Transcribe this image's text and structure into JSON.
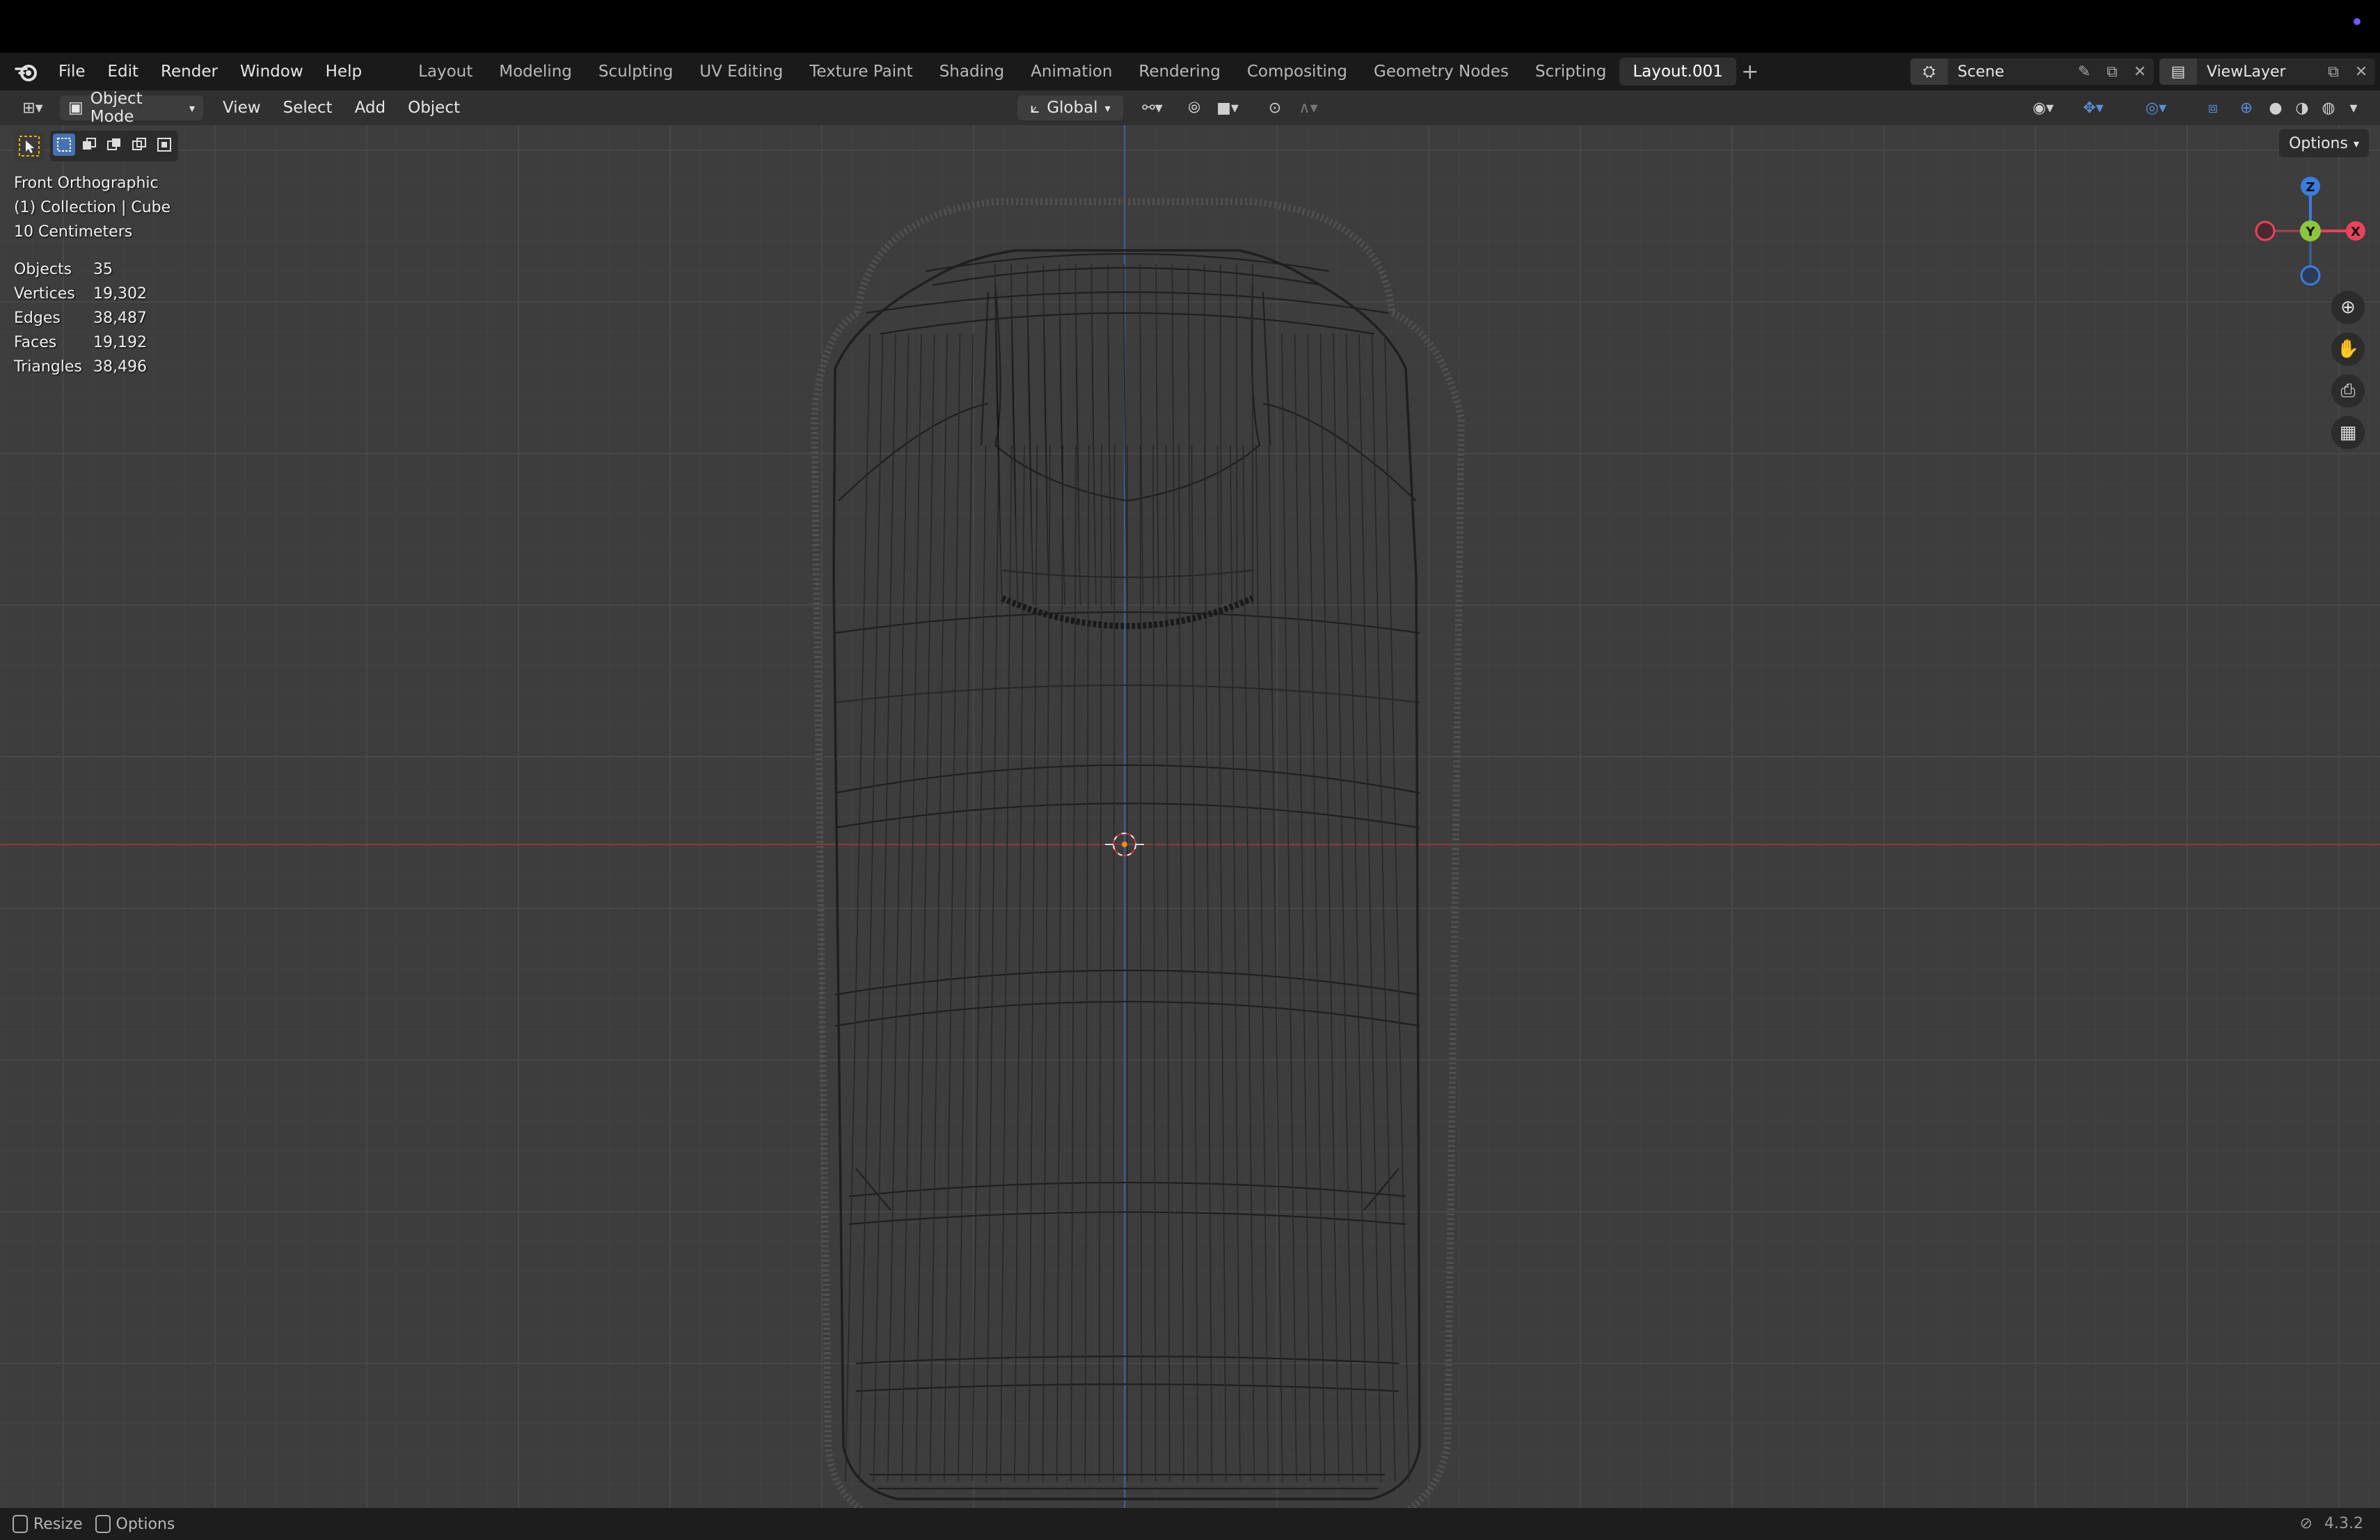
{
  "menubar": {
    "items": [
      "File",
      "Edit",
      "Render",
      "Window",
      "Help"
    ],
    "workspaces": [
      "Layout",
      "Modeling",
      "Sculpting",
      "UV Editing",
      "Texture Paint",
      "Shading",
      "Animation",
      "Rendering",
      "Compositing",
      "Geometry Nodes",
      "Scripting",
      "Layout.001"
    ],
    "active_workspace": "Layout.001",
    "add_tab": "+",
    "scene": "Scene",
    "view_layer": "ViewLayer"
  },
  "header": {
    "mode": "Object Mode",
    "menus": [
      "View",
      "Select",
      "Add",
      "Object"
    ],
    "transform_orientation": "Global"
  },
  "viewport": {
    "view_name": "Front Orthographic",
    "collection": "(1) Collection | Cube",
    "scale": "10 Centimeters",
    "stats": [
      {
        "label": "Objects",
        "value": "35"
      },
      {
        "label": "Vertices",
        "value": "19,302"
      },
      {
        "label": "Edges",
        "value": "38,487"
      },
      {
        "label": "Faces",
        "value": "19,192"
      },
      {
        "label": "Triangles",
        "value": "38,496"
      }
    ],
    "options_label": "Options",
    "gizmo": {
      "z": "Z",
      "y": "Y",
      "x": "X"
    }
  },
  "colors": {
    "axis_x": "#e8445a",
    "axis_y": "#8cc63f",
    "axis_z": "#3b7ddd",
    "accent": "#4772b3"
  },
  "statusbar": {
    "resize": "Resize",
    "options": "Options",
    "version": "4.3.2"
  }
}
